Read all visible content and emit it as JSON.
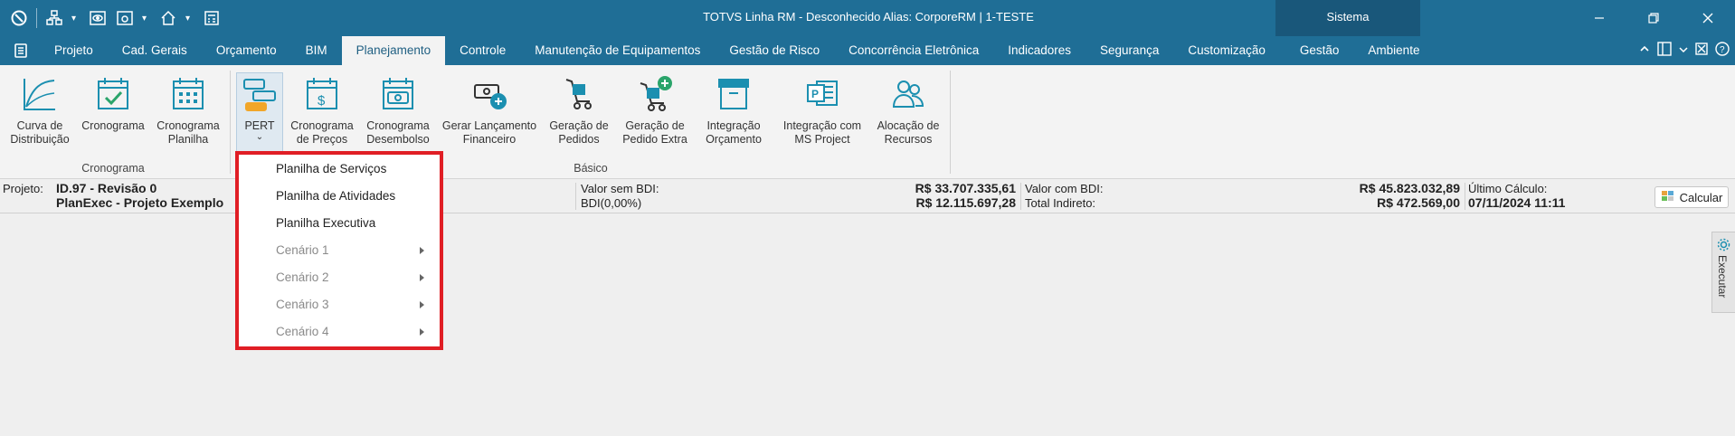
{
  "window": {
    "title": "TOTVS Linha RM - Desconhecido  Alias: CorporeRM | 1-TESTE",
    "context_tab": "Sistema"
  },
  "tabs": [
    {
      "label": "Projeto"
    },
    {
      "label": "Cad. Gerais"
    },
    {
      "label": "Orçamento"
    },
    {
      "label": "BIM"
    },
    {
      "label": "Planejamento",
      "active": true
    },
    {
      "label": "Controle"
    },
    {
      "label": "Manutenção de Equipamentos"
    },
    {
      "label": "Gestão de Risco"
    },
    {
      "label": "Concorrência Eletrônica"
    },
    {
      "label": "Indicadores"
    },
    {
      "label": "Segurança"
    },
    {
      "label": "Customização"
    },
    {
      "label": "Gestão"
    },
    {
      "label": "Ambiente"
    }
  ],
  "ribbon": {
    "buttons": [
      {
        "label": "Curva de\nDistribuição",
        "icon": "curve-chart-icon"
      },
      {
        "label": "Cronograma\n ",
        "icon": "calendar-check-icon",
        "dropdown": true
      },
      {
        "label": "Cronograma\nPlanilha",
        "icon": "calendar-grid-icon",
        "dropdown": true
      },
      {
        "label": "PERT",
        "icon": "pert-icon",
        "dropdown": true,
        "pressed": true
      },
      {
        "label": "Cronograma\nde Preços",
        "icon": "calendar-dollar-icon"
      },
      {
        "label": "Cronograma\nDesembolso",
        "icon": "calendar-money-icon"
      },
      {
        "label": "Gerar Lançamento\nFinanceiro",
        "icon": "money-add-icon"
      },
      {
        "label": "Geração de\nPedidos",
        "icon": "cart-icon"
      },
      {
        "label": "Geração de\nPedido Extra",
        "icon": "cart-plus-icon"
      },
      {
        "label": "Integração\nOrçamento",
        "icon": "archive-icon",
        "dropdown": true
      },
      {
        "label": "Integração com\nMS Project",
        "icon": "ms-project-icon",
        "dropdown": true
      },
      {
        "label": "Alocação de\nRecursos",
        "icon": "people-icon",
        "dropdown": true
      }
    ],
    "groups": [
      "Cronograma",
      "Básico"
    ]
  },
  "info": {
    "projeto_label": "Projeto:",
    "projeto_id": "ID.97 - Revisão 0",
    "projeto_name": "PlanExec - Projeto Exemplo",
    "valor_sem_bdi_label": "Valor sem BDI:",
    "valor_sem_bdi": "R$ 33.707.335,61",
    "bdi_label": "BDI(0,00%)",
    "bdi_value": "R$ 12.115.697,28",
    "valor_com_bdi_label": "Valor com BDI:",
    "valor_com_bdi": "R$ 45.823.032,89",
    "total_indireto_label": "Total Indireto:",
    "total_indireto": "R$ 472.569,00",
    "ultimo_calculo_label": "Último Cálculo:",
    "ultimo_calculo": "07/11/2024 11:11",
    "calcular": "Calcular"
  },
  "dropdown": {
    "items": [
      {
        "label": "Planilha de Serviços",
        "enabled": true
      },
      {
        "label": "Planilha de Atividades",
        "enabled": true
      },
      {
        "label": "Planilha Executiva",
        "enabled": true
      },
      {
        "label": "Cenário 1",
        "enabled": false,
        "submenu": true
      },
      {
        "label": "Cenário 2",
        "enabled": false,
        "submenu": true
      },
      {
        "label": "Cenário 3",
        "enabled": false,
        "submenu": true
      },
      {
        "label": "Cenário 4",
        "enabled": false,
        "submenu": true
      }
    ]
  },
  "side_panel": {
    "executar": "Executar"
  },
  "colors": {
    "titlebar": "#1f6e96",
    "accent": "#1b8fb0",
    "highlight_box": "#e01e25"
  }
}
